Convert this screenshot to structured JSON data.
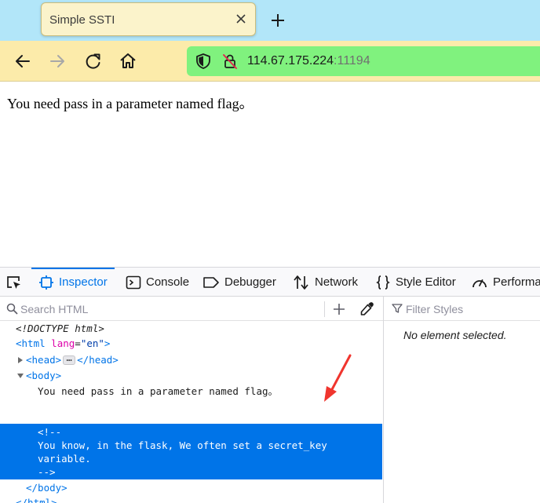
{
  "browser": {
    "tab": {
      "title": "Simple SSTI"
    },
    "url": {
      "host": "114.67.175.224",
      "port": ":11194"
    }
  },
  "page": {
    "text": "You need pass in a parameter named flag。"
  },
  "devtools": {
    "tabs": [
      {
        "label": "Inspector",
        "icon": "inspector-icon",
        "active": true
      },
      {
        "label": "Console",
        "icon": "console-icon"
      },
      {
        "label": "Debugger",
        "icon": "debugger-icon"
      },
      {
        "label": "Network",
        "icon": "network-icon"
      },
      {
        "label": "Style Editor",
        "icon": "style-editor-icon"
      },
      {
        "label": "Performa",
        "icon": "performance-icon"
      }
    ],
    "search": {
      "placeholder": "Search HTML"
    },
    "filter": {
      "placeholder": "Filter Styles"
    },
    "rules_empty": "No element selected.",
    "markup": {
      "doctype": "<!DOCTYPE html>",
      "html_open": "<html",
      "lang_attr": "lang",
      "lang_value": "\"en\"",
      "gt": ">",
      "head_open": "<head>",
      "head_close": "</head>",
      "body_open": "<body>",
      "body_text": "You need pass in a parameter named flag。",
      "comment_lines": [
        "<!--",
        "You know, in the flask, We often set a secret_key",
        "variable.",
        "-->"
      ],
      "body_close": "</body>",
      "html_close": "</html>"
    }
  },
  "colors": {
    "tabstrip": "#b2e6f9",
    "navbar": "#fcebaa",
    "urlbar": "#80f27e",
    "selection": "#0074e8",
    "annotation_arrow": "#f0352e"
  }
}
